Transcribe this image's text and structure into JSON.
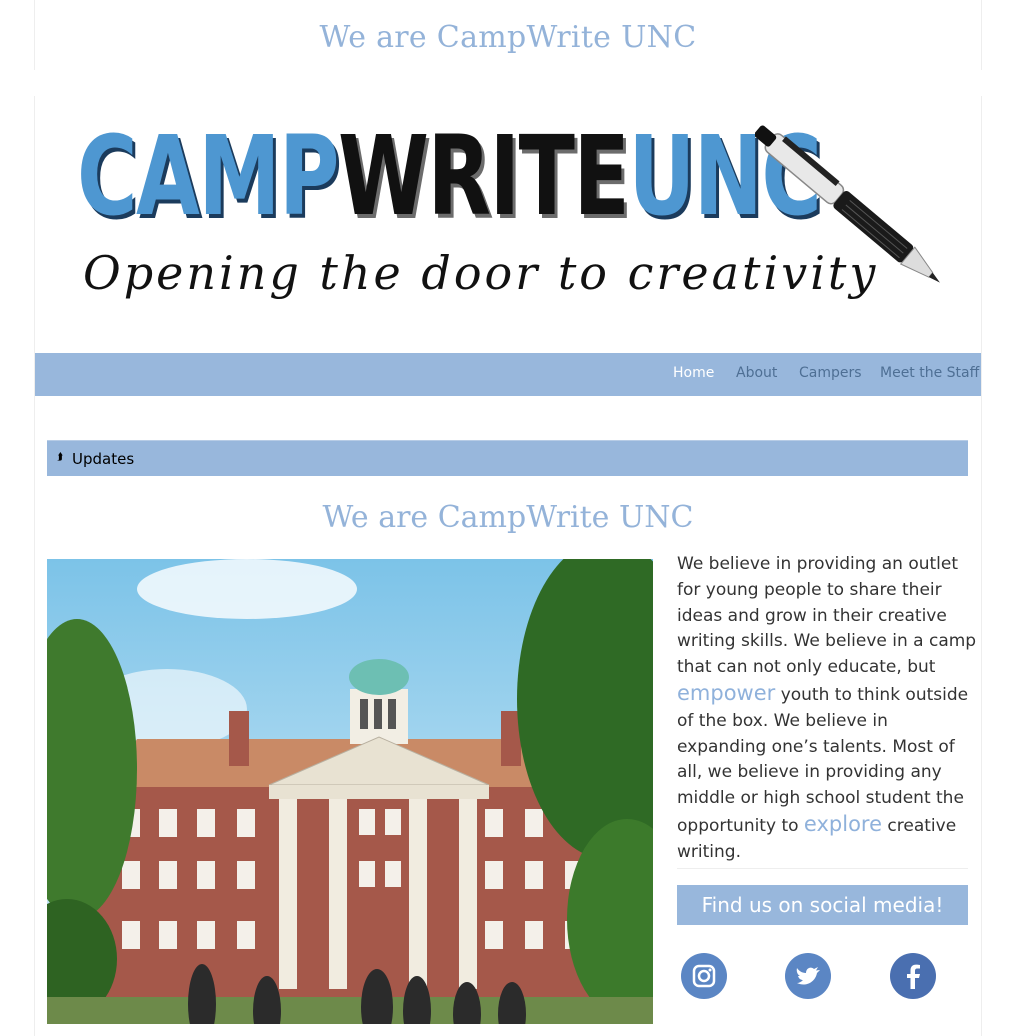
{
  "header": {
    "title": "We are CampWrite UNC"
  },
  "logo": {
    "camp": "CAMP",
    "write": "WRITE",
    "unc": "UNC",
    "tagline": "Opening the door to creativity"
  },
  "nav": {
    "items": [
      {
        "label": "Home",
        "active": true
      },
      {
        "label": "About",
        "active": false
      },
      {
        "label": "Campers",
        "active": false
      },
      {
        "label": "Meet the Staff",
        "active": false
      }
    ]
  },
  "updates": {
    "label": "Updates",
    "icon": "double-chevron-up-icon"
  },
  "main": {
    "title": "We are CampWrite UNC",
    "about": {
      "p1": "We believe in providing an outlet for young people to share their ideas and grow in their creative writing skills. We believe in a camp that can not only educate, but ",
      "highlight1": "empower",
      "p2": " youth to think outside of the box. We believe in expanding one’s talents. Most of all, we believe in providing any middle or high school student the opportunity to ",
      "highlight2": "explore",
      "p3": " creative writing."
    },
    "social": {
      "title": "Find us on social media!",
      "icons": [
        "instagram-icon",
        "twitter-icon",
        "facebook-icon"
      ]
    }
  },
  "colors": {
    "accent": "#98b7dc",
    "title": "#94b3d9",
    "logo_blue": "#4e97d1",
    "social_blue": "#5b86c4"
  }
}
